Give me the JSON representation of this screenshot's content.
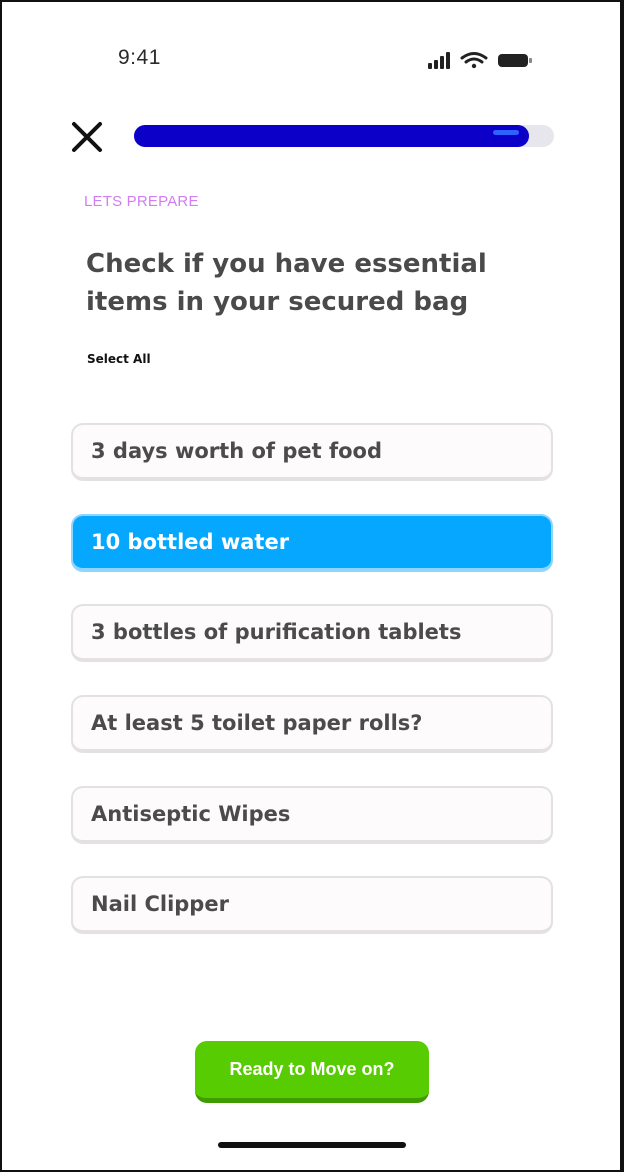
{
  "status_bar": {
    "time": "9:41",
    "icons": [
      "cellular-signal-icon",
      "wifi-icon",
      "battery-icon"
    ]
  },
  "header": {
    "close_icon": "close-icon",
    "progress": 0.94
  },
  "content": {
    "eyebrow": "LETS PREPARE",
    "title": "Check if you have essential items in your secured bag",
    "select_all": "Select All",
    "options": [
      {
        "label": "3 days worth of pet food",
        "selected": false
      },
      {
        "label": "10 bottled water",
        "selected": true
      },
      {
        "label": "3 bottles of purification tablets",
        "selected": false
      },
      {
        "label": "At least 5 toilet paper rolls?",
        "selected": false
      },
      {
        "label": "Antiseptic Wipes",
        "selected": false
      },
      {
        "label": "Nail Clipper",
        "selected": false
      }
    ]
  },
  "footer": {
    "cta_label": "Ready to Move on?"
  },
  "colors": {
    "progress_fill": "#0c00c8",
    "selected_option": "#05a7ff",
    "eyebrow": "#d07ef2",
    "cta": "#58cc02"
  }
}
